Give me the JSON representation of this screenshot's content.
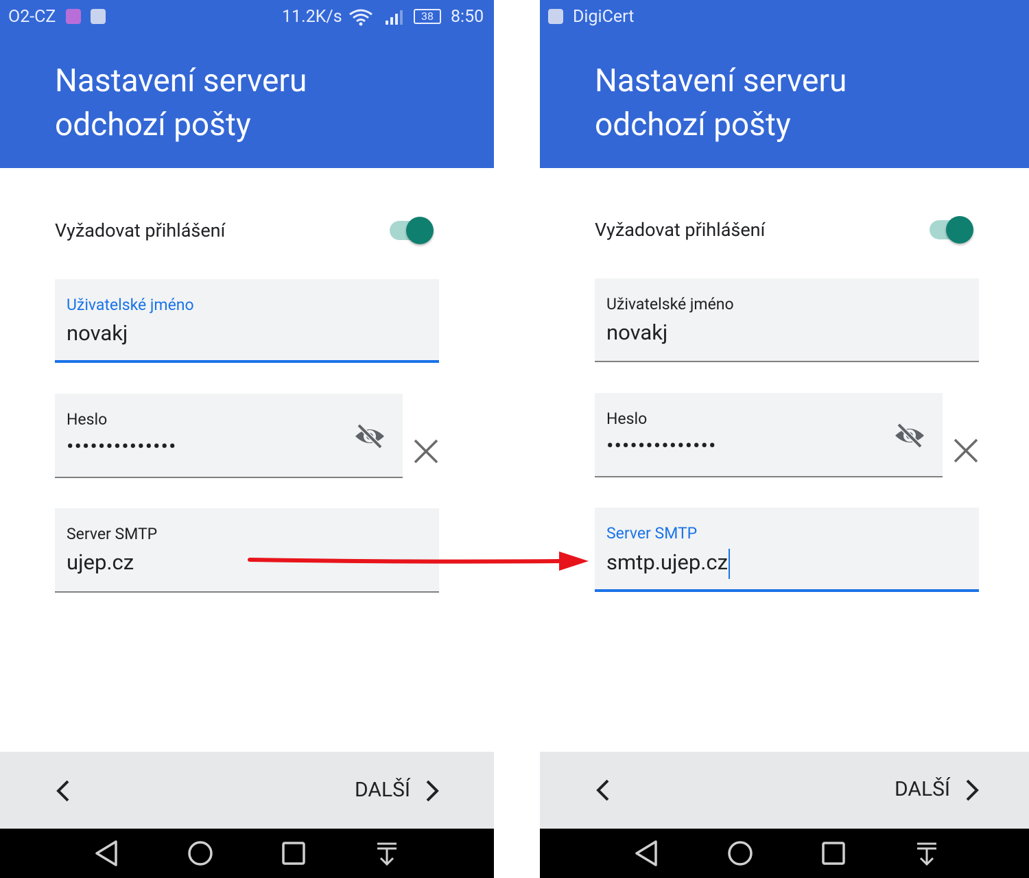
{
  "left_screen": {
    "status_bar": {
      "carrier": "O2-CZ",
      "speed": "11.2K/s",
      "battery": "38",
      "time": "8:50"
    },
    "header": {
      "title_line1": "Nastavení serveru",
      "title_line2": "odchozí pošty"
    },
    "toggle": {
      "label": "Vyžadovat přihlášení",
      "on": true
    },
    "username": {
      "label": "Uživatelské jméno",
      "value": "novakj"
    },
    "password": {
      "label": "Heslo",
      "value": "••••••••••••••"
    },
    "smtp": {
      "label": "Server SMTP",
      "value": "ujep.cz"
    },
    "footer": {
      "next_label": "DALŠÍ"
    }
  },
  "right_screen": {
    "status_bar": {
      "app_name": "DigiCert"
    },
    "header": {
      "title_line1": "Nastavení serveru",
      "title_line2": "odchozí pošty"
    },
    "toggle": {
      "label": "Vyžadovat přihlášení",
      "on": true
    },
    "username": {
      "label": "Uživatelské jméno",
      "value": "novakj"
    },
    "password": {
      "label": "Heslo",
      "value": "••••••••••••••"
    },
    "smtp": {
      "label": "Server SMTP",
      "value": "smtp.ujep.cz"
    },
    "footer": {
      "next_label": "DALŠÍ"
    }
  },
  "colors": {
    "header": "#3367d6",
    "accent_blue": "#1a73e8",
    "toggle_thumb": "#0f7f6f",
    "toggle_track": "#a8d7d0",
    "field_bg": "#f1f3f4",
    "bottom_bar": "#e7e8ea",
    "nav_bar": "#000000",
    "annotation_arrow": "#e8141b"
  },
  "icons": [
    "gallery-notification-icon",
    "mail-notification-icon",
    "wifi-icon",
    "signal-icon",
    "battery-icon",
    "eye-off-icon",
    "close-icon",
    "chevron-left-icon",
    "chevron-right-icon",
    "nav-back-icon",
    "nav-home-icon",
    "nav-recents-icon",
    "nav-pulldown-icon",
    "red-arrow-annotation"
  ]
}
